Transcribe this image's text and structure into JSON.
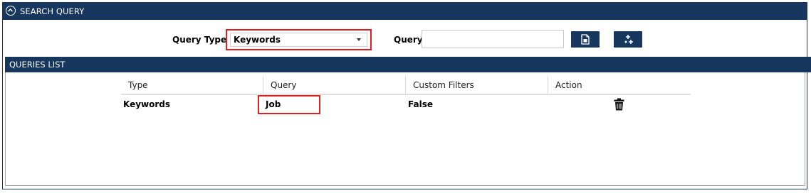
{
  "header": {
    "title": "SEARCH QUERY"
  },
  "form": {
    "query_type_label": "Query Type",
    "query_type_value": "Keywords",
    "query_label": "Query",
    "query_value": ""
  },
  "list": {
    "title": "QUERIES LIST",
    "columns": [
      "Type",
      "Query",
      "Custom Filters",
      "Action"
    ],
    "rows": [
      {
        "type": "Keywords",
        "query": "Job",
        "custom_filters": "False"
      }
    ]
  },
  "colors": {
    "header_bg": "#17375e",
    "highlight": "#e0201e"
  },
  "icons": {
    "collapse": "chevron-up-circle-icon",
    "btn1": "document-icon",
    "btn2": "add-icon",
    "delete": "trash-icon"
  }
}
